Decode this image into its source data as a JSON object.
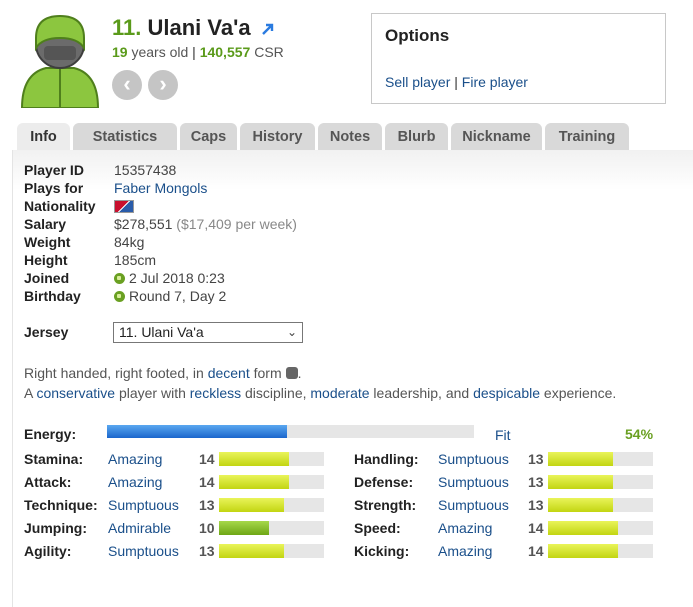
{
  "player": {
    "number": "11.",
    "name": "Ulani Va'a",
    "age": "19",
    "age_suffix": "years old",
    "csr": "140,557",
    "csr_label": "CSR"
  },
  "options": {
    "title": "Options",
    "sell": "Sell player",
    "fire": "Fire player"
  },
  "tabs": [
    "Info",
    "Statistics",
    "Caps",
    "History",
    "Notes",
    "Blurb",
    "Nickname",
    "Training"
  ],
  "active_tab": "Info",
  "info": {
    "player_id_label": "Player ID",
    "player_id": "15357438",
    "plays_for_label": "Plays for",
    "plays_for": "Faber Mongols",
    "nationality_label": "Nationality",
    "salary_label": "Salary",
    "salary": "$278,551",
    "salary_weekly": "($17,409 per week)",
    "weight_label": "Weight",
    "weight": "84kg",
    "height_label": "Height",
    "height": "185cm",
    "joined_label": "Joined",
    "joined": "2 Jul 2018 0:23",
    "birthday_label": "Birthday",
    "birthday": "Round 7, Day 2"
  },
  "jersey": {
    "label": "Jersey",
    "selected": "11. Ulani Va'a"
  },
  "description": {
    "line1_pre": "Right handed, right footed, in ",
    "form": "decent",
    "line1_post": " form",
    "line2_a": "A ",
    "personality": "conservative",
    "line2_b": " player with ",
    "discipline": "reckless",
    "line2_c": " discipline, ",
    "leadership": "moderate",
    "line2_d": " leadership, and ",
    "experience": "despicable",
    "line2_e": " experience."
  },
  "energy": {
    "label": "Energy:",
    "status": "Fit",
    "percent": "54%",
    "fill_fraction": 0.49
  },
  "skills_left": [
    {
      "name": "Stamina:",
      "desc": "Amazing",
      "level": "14",
      "fraction": 0.67
    },
    {
      "name": "Attack:",
      "desc": "Amazing",
      "level": "14",
      "fraction": 0.67
    },
    {
      "name": "Technique:",
      "desc": "Sumptuous",
      "level": "13",
      "fraction": 0.62
    },
    {
      "name": "Jumping:",
      "desc": "Admirable",
      "level": "10",
      "fraction": 0.48
    },
    {
      "name": "Agility:",
      "desc": "Sumptuous",
      "level": "13",
      "fraction": 0.62
    }
  ],
  "skills_right": [
    {
      "name": "Handling:",
      "desc": "Sumptuous",
      "level": "13",
      "fraction": 0.62
    },
    {
      "name": "Defense:",
      "desc": "Sumptuous",
      "level": "13",
      "fraction": 0.62
    },
    {
      "name": "Strength:",
      "desc": "Sumptuous",
      "level": "13",
      "fraction": 0.62
    },
    {
      "name": "Speed:",
      "desc": "Amazing",
      "level": "14",
      "fraction": 0.67
    },
    {
      "name": "Kicking:",
      "desc": "Amazing",
      "level": "14",
      "fraction": 0.67
    }
  ],
  "colors": {
    "accent_green": "#5a9a1a",
    "link_blue": "#1a4f8a",
    "energy_blue": "#1b66cc"
  }
}
